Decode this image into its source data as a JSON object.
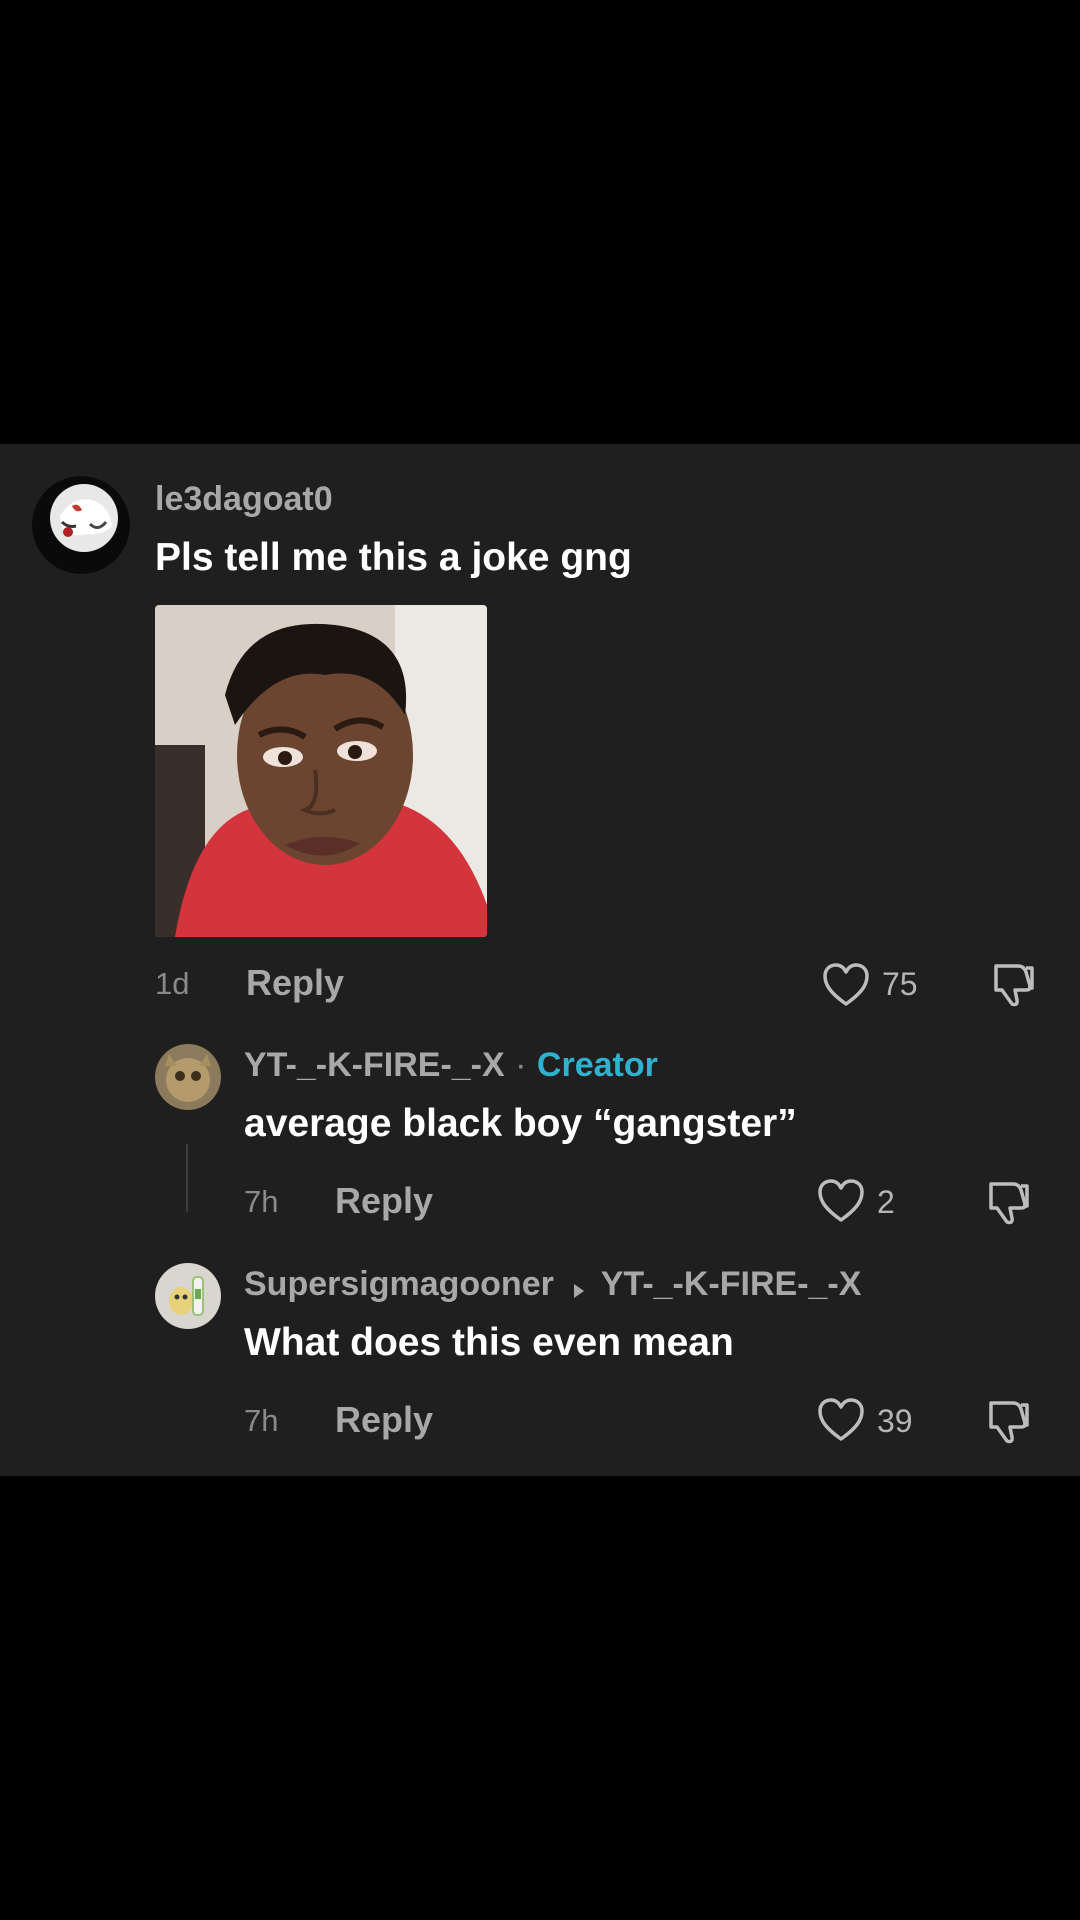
{
  "comments": [
    {
      "username": "le3dagoat0",
      "text": "Pls tell me this a joke gng",
      "time": "1d",
      "reply_label": "Reply",
      "likes": "75"
    }
  ],
  "replies": [
    {
      "username": "YT-_-K-FIRE-_-X",
      "separator": "·",
      "badge": "Creator",
      "text": "average black boy “gangster”",
      "time": "7h",
      "reply_label": "Reply",
      "likes": "2"
    },
    {
      "username": "Supersigmagooner",
      "reply_to": "YT-_-K-FIRE-_-X",
      "text": "What does this even mean",
      "time": "7h",
      "reply_label": "Reply",
      "likes": "39"
    }
  ],
  "colors": {
    "background": "#000000",
    "panel": "#1f1f1f",
    "creator_badge": "#2fb2cf"
  },
  "icons": [
    "heart-icon",
    "dislike-icon",
    "reply-arrow-icon"
  ]
}
